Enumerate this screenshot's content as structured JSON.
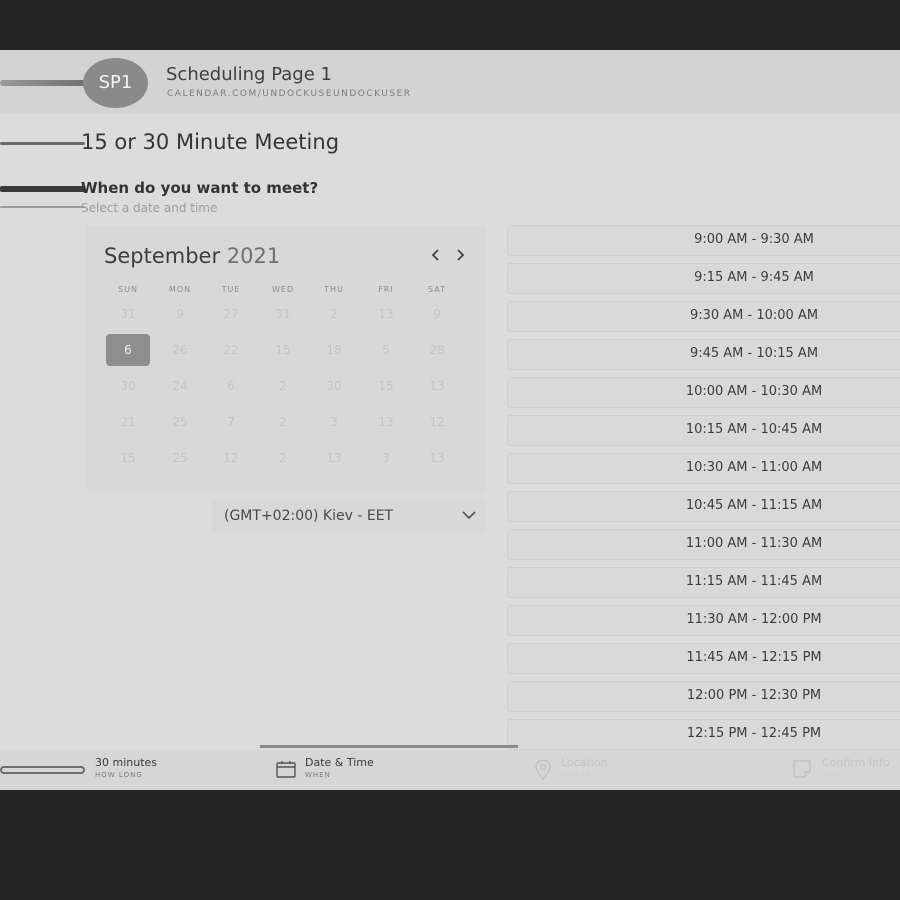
{
  "header": {
    "avatar_initials": "SP1",
    "title": "Scheduling Page 1",
    "url": "CALENDAR.COM/UNDOCKUSEUNDOCKUSER"
  },
  "meeting": {
    "title": "15 or 30 Minute Meeting",
    "question": "When do you want to meet?",
    "subtext": "Select a date and time"
  },
  "calendar": {
    "month": "September",
    "year": "2021",
    "prev_icon": "chevron-left-icon",
    "next_icon": "chevron-right-icon",
    "weekdays": [
      "SUN",
      "MON",
      "TUE",
      "WED",
      "THU",
      "FRI",
      "SAT"
    ],
    "weeks": [
      [
        "31",
        "9",
        "27",
        "31",
        "2",
        "13",
        "9"
      ],
      [
        "6",
        "26",
        "22",
        "15",
        "18",
        "5",
        "28"
      ],
      [
        "30",
        "24",
        "6",
        "2",
        "30",
        "15",
        "13"
      ],
      [
        "21",
        "25",
        "7",
        "2",
        "3",
        "13",
        "12"
      ],
      [
        "15",
        "25",
        "12",
        "2",
        "13",
        "3",
        "13"
      ]
    ],
    "selected_day": "6"
  },
  "timezone": {
    "value": "(GMT+02:00) Kiev - EET",
    "icon": "chevron-down-icon"
  },
  "slots": [
    "9:00 AM - 9:30 AM",
    "9:15 AM - 9:45 AM",
    "9:30 AM - 10:00 AM",
    "9:45 AM - 10:15 AM",
    "10:00 AM - 10:30 AM",
    "10:15 AM - 10:45 AM",
    "10:30 AM - 11:00 AM",
    "10:45 AM - 11:15 AM",
    "11:00 AM - 11:30 AM",
    "11:15 AM - 11:45 AM",
    "11:30 AM - 12:00 PM",
    "11:45 AM - 12:15 PM",
    "12:00 PM - 12:30 PM",
    "12:15 PM - 12:45 PM"
  ],
  "footer": {
    "steps": [
      {
        "title": "30 minutes",
        "sub": "HOW LONG"
      },
      {
        "title": "Date & Time",
        "sub": "WHEN",
        "icon": "calendar-icon"
      },
      {
        "title": "Location",
        "sub": "WHERE",
        "icon": "location-pin-icon"
      },
      {
        "title": "Confirm Info",
        "sub": "WHO",
        "icon": "note-icon"
      }
    ]
  },
  "colors": {
    "background": "#242424",
    "panel": "#dcdcdc",
    "selected_day": "#8e8e8e"
  }
}
